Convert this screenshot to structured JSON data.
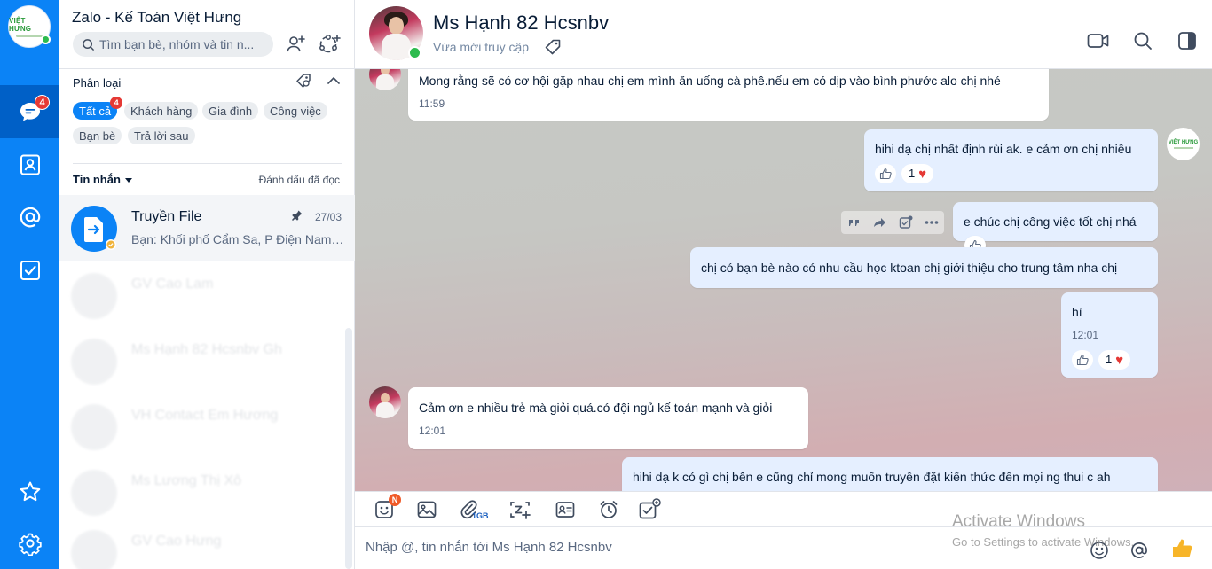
{
  "rail": {
    "messages_badge": "4",
    "logo_text": "VIỆT HƯNG"
  },
  "list": {
    "app_title": "Zalo - Kế Toán Việt Hưng",
    "search_placeholder": "Tìm bạn bè, nhóm và tin n...",
    "filter_title": "Phân loại",
    "chips": [
      {
        "label": "Tất cả",
        "badge": "4"
      },
      {
        "label": "Khách hàng"
      },
      {
        "label": "Gia đình"
      },
      {
        "label": "Công việc"
      },
      {
        "label": "Bạn bè"
      },
      {
        "label": "Trả lời sau"
      }
    ],
    "messages_label": "Tin nhắn",
    "mark_read": "Đánh dấu đã đọc",
    "conversations": [
      {
        "name": "Truyền File",
        "preview": "Bạn: Khối phố Cẩm Sa, P Điện Nam ...",
        "time": "27/03"
      },
      {
        "name": "GV Cao Lam",
        "preview": "",
        "time": ""
      },
      {
        "name": "Ms Hạnh 82 Hcsnbv Gh",
        "preview": "",
        "time": ""
      },
      {
        "name": "VH Contact Em Hương",
        "preview": "",
        "time": ""
      },
      {
        "name": "Ms Lương Thị Xô",
        "preview": "",
        "time": ""
      },
      {
        "name": "GV Cao Hưng",
        "preview": "",
        "time": ""
      }
    ]
  },
  "chat": {
    "name": "Ms Hạnh 82 Hcsnbv",
    "status": "Vừa mới truy cập",
    "messages": [
      {
        "dir": "in",
        "text": "Mong rằng sẽ có cơ hội gặp nhau chị em mình ăn uống cà phê.nếu em có dịp vào bình phước alo chị nhé",
        "time": "11:59"
      },
      {
        "dir": "out",
        "text": "hihi dạ chị nhất định rùi ak. e cảm ơn chị nhiều",
        "reaction_count": "1"
      },
      {
        "dir": "out",
        "text": "e chúc chị công việc tốt chị nhá"
      },
      {
        "dir": "out",
        "text": "chị có bạn bè nào có nhu cầu học ktoan chị giới thiệu cho trung tâm nha chị"
      },
      {
        "dir": "out",
        "text": "hì",
        "time": "12:01",
        "reaction_count": "1"
      },
      {
        "dir": "in",
        "text": "Cảm ơn e nhiều trẻ mà giỏi quá.có đội ngủ kế toán mạnh và giỏi",
        "time": "12:01"
      },
      {
        "dir": "out",
        "text": "hihi dạ k có gì chị bên e cũng chỉ mong muốn truyền đặt kiến thức đến mọi ng thui c ah"
      }
    ],
    "composer_placeholder": "Nhập @, tin nhắn tới Ms Hạnh 82 Hcsnbv",
    "attach_size": "1GB",
    "sticker_badge": "N"
  },
  "watermark": {
    "line1": "Activate Windows",
    "line2": "Go to Settings to activate Windows."
  },
  "colors": {
    "brand": "#0b83f6",
    "rail_active": "#0060c7",
    "out_bubble": "#e5efff",
    "badge": "#e53935",
    "online": "#2dbb4e"
  }
}
